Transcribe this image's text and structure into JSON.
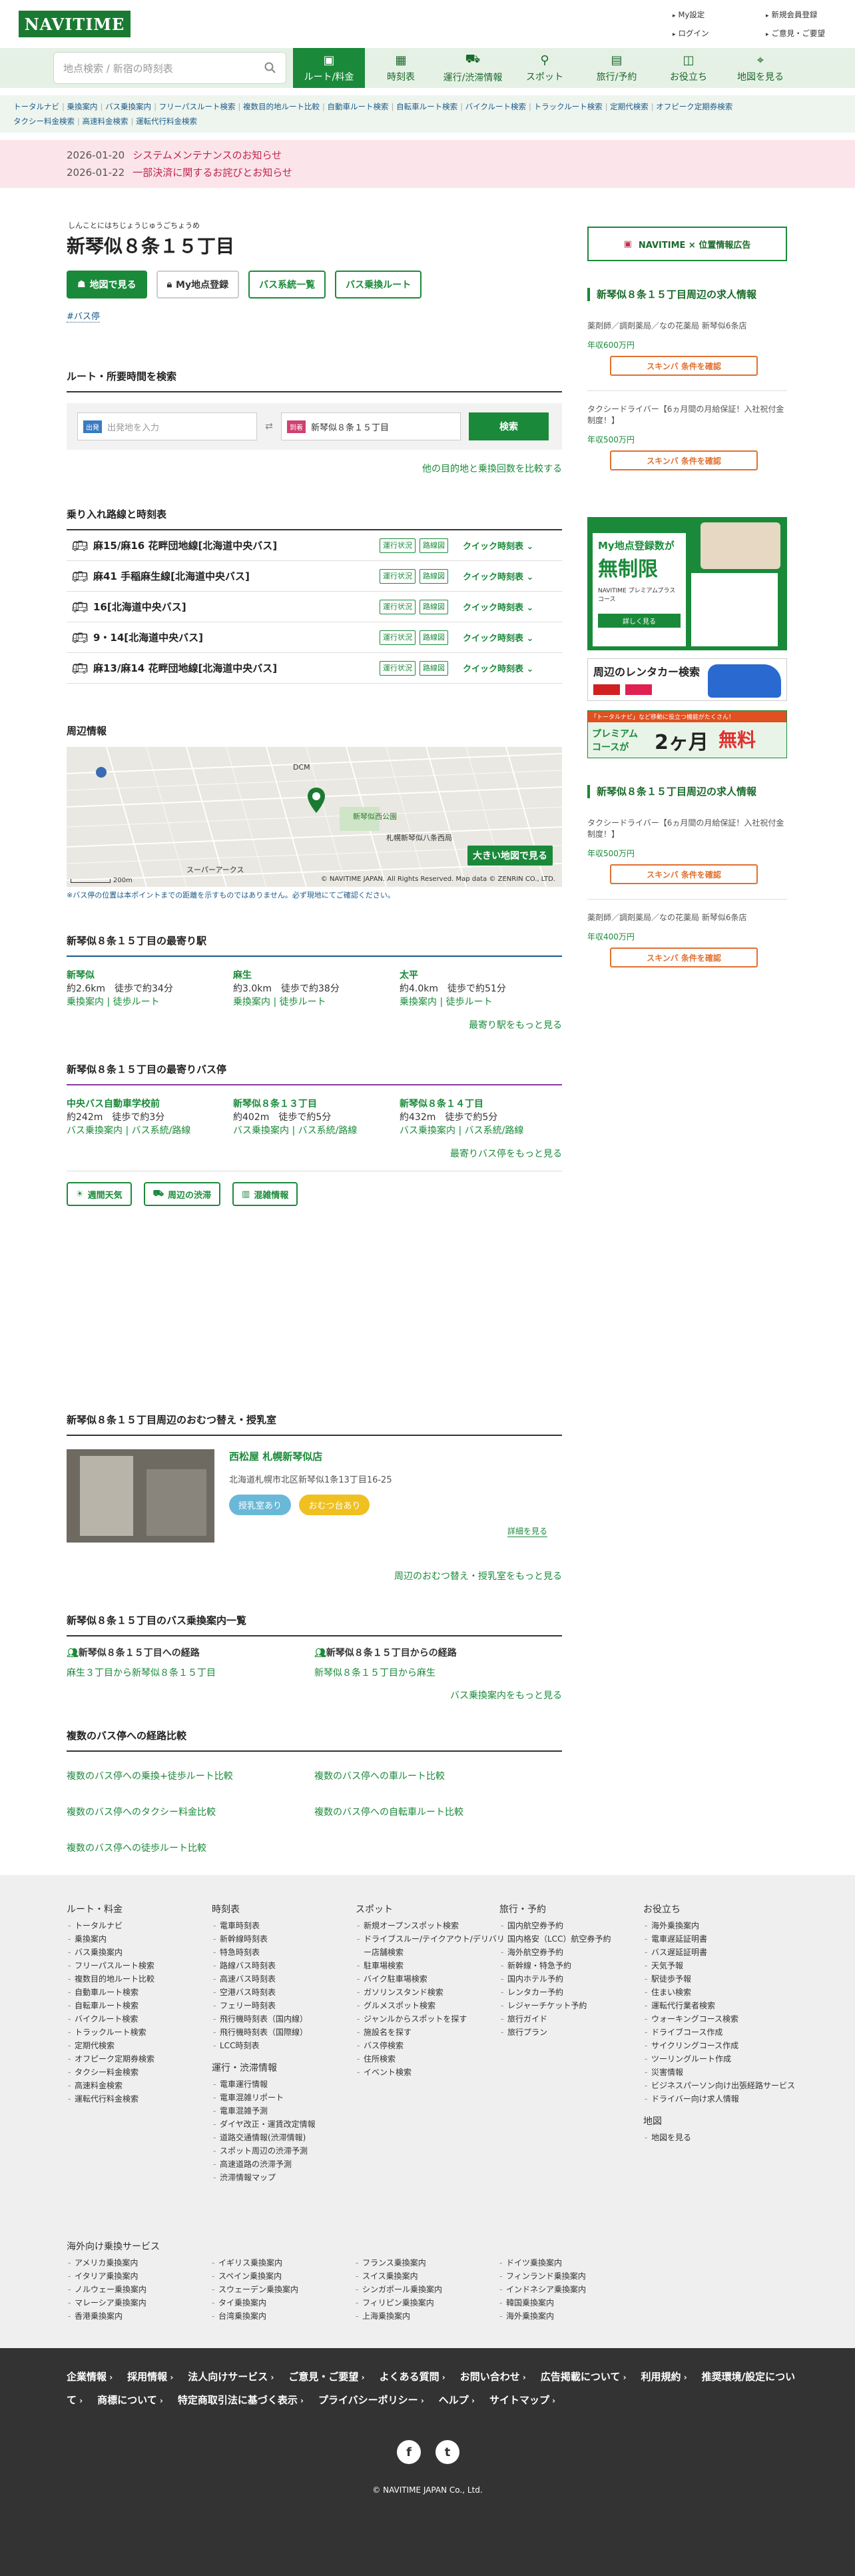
{
  "header": {
    "logo": "NAVITIME",
    "links": [
      "My設定",
      "新規会員登録",
      "ログイン",
      "ご意見・ご要望"
    ]
  },
  "nav": {
    "search_placeholder": "地点検索 / 新宿の時刻表",
    "tabs": [
      {
        "label": "ルート/料金",
        "icon": "route-icon"
      },
      {
        "label": "時刻表",
        "icon": "timetable-icon"
      },
      {
        "label": "運行/渋滞情報",
        "icon": "train-icon"
      },
      {
        "label": "スポット",
        "icon": "pin-icon"
      },
      {
        "label": "旅行/予約",
        "icon": "suitcase-icon"
      },
      {
        "label": "お役立ち",
        "icon": "gift-icon"
      },
      {
        "label": "地図を見る",
        "icon": "map-icon"
      }
    ]
  },
  "subnav": [
    "トータルナビ",
    "乗換案内",
    "バス乗換案内",
    "フリーパスルート検索",
    "複数目的地ルート比較",
    "自動車ルート検索",
    "自転車ルート検索",
    "バイクルート検索",
    "トラックルート検索",
    "定期代検索",
    "オフピーク定期券検索",
    "タクシー料金検索",
    "高速料金検索",
    "運転代行料金検索"
  ],
  "news": [
    {
      "date": "2026-01-20",
      "text": "システムメンテナンスのお知らせ"
    },
    {
      "date": "2026-01-22",
      "text": "一部決済に関するお詫びとお知らせ"
    }
  ],
  "page": {
    "ruby": "しんことにはちじょうじゅうごちょうめ",
    "title": "新琴似８条１５丁目",
    "buttons": [
      "地図で見る",
      "My地点登録",
      "バス系統一覧",
      "バス乗換ルート"
    ],
    "tag": "#バス停"
  },
  "route": {
    "heading": "ルート・所要時間を検索",
    "from_badge": "出発",
    "from_placeholder": "出発地を入力",
    "to_badge": "到着",
    "to_value": "新琴似８条１５丁目",
    "swap": "⇄",
    "search": "検索",
    "link": "他の目的地と乗換回数を比較する"
  },
  "lines": {
    "heading": "乗り入れ路線と時刻表",
    "items": [
      "麻15/麻16 花畔団地線[北海道中央バス]",
      "麻41 手稲麻生線[北海道中央バス]",
      "16[北海道中央バス]",
      "9・14[北海道中央バス]",
      "麻13/麻14 花畔団地線[北海道中央バス]"
    ],
    "status": "運行状況",
    "timetable": "路線図",
    "quick": "クイック時刻表"
  },
  "map": {
    "heading": "周辺情報",
    "labels": [
      "DCM",
      "新琴似西公園",
      "札幌新琴似八条西局",
      "スーパーアークス"
    ],
    "button": "大きい地図で見る",
    "scale": "200m",
    "copyright": "© NAVITIME JAPAN. All Rights Reserved. Map data © ZENRIN CO., LTD.",
    "note": "※バス停の位置は本ポイントまでの距離を示すものではありません。必ず現地にてご確認ください。"
  },
  "stations": {
    "heading": "新琴似８条１５丁目の最寄り駅",
    "items": [
      {
        "name": "新琴似",
        "dist": "約2.6km　徒歩で約34分",
        "links": "乗換案内 | 徒歩ルート"
      },
      {
        "name": "麻生",
        "dist": "約3.0km　徒歩で約38分",
        "links": "乗換案内 | 徒歩ルート"
      },
      {
        "name": "太平",
        "dist": "約4.0km　徒歩で約51分",
        "links": "乗換案内 | 徒歩ルート"
      }
    ],
    "more": "最寄り駅をもっと見る"
  },
  "busstops": {
    "heading": "新琴似８条１５丁目の最寄りバス停",
    "items": [
      {
        "name": "中央バス自動車学校前",
        "dist": "約242m　徒歩で約3分",
        "links": "バス乗換案内 | バス系統/路線"
      },
      {
        "name": "新琴似８条１３丁目",
        "dist": "約402m　徒歩で約5分",
        "links": "バス乗換案内 | バス系統/路線"
      },
      {
        "name": "新琴似８条１４丁目",
        "dist": "約432m　徒歩で約5分",
        "links": "バス乗換案内 | バス系統/路線"
      }
    ],
    "more": "最寄りバス停をもっと見る"
  },
  "weather": [
    "週間天気",
    "周辺の渋滞",
    "混雑情報"
  ],
  "diaper": {
    "heading": "新琴似８条１５丁目周辺のおむつ替え・授乳室",
    "name": "西松屋 札幌新琴似店",
    "address": "北海道札幌市北区新琴似1条13丁目16-25",
    "tags": [
      "授乳室あり",
      "おむつ台あり"
    ],
    "detail": "詳細を見る",
    "more": "周辺のおむつ替え・授乳室をもっと見る"
  },
  "busroute": {
    "heading": "新琴似８条１５丁目のバス乗換案内一覧",
    "to_title": "新琴似８条１５丁目への経路",
    "to_link": "麻生３丁目から新琴似８条１５丁目",
    "from_title": "新琴似８条１５丁目からの経路",
    "from_link": "新琴似８条１５丁目から麻生",
    "more": "バス乗換案内をもっと見る"
  },
  "compare": {
    "heading": "複数のバス停への経路比較",
    "links": [
      "複数のバス停への乗換+徒歩ルート比較",
      "複数のバス停への車ルート比較",
      "複数のバス停へのタクシー料金比較",
      "複数のバス停への自転車ルート比較",
      "複数のバス停への徒歩ルート比較"
    ]
  },
  "side": {
    "ad": "NAVITIME × 位置情報広告",
    "job_title": "新琴似８条１５丁目周辺の求人情報",
    "jobs": [
      {
        "text": "薬剤師／調剤薬局／なの花薬局 新琴似6条店",
        "pay": "年収600万円"
      },
      {
        "text": "タクシードライバー【6ヵ月間の月給保証！入社祝付金制度！】",
        "pay": "年収500万円"
      }
    ],
    "jobs2": [
      {
        "text": "タクシードライバー【6ヵ月間の月給保証！入社祝付金制度！】",
        "pay": "年収500万円"
      },
      {
        "text": "薬剤師／調剤薬局／なの花薬局 新琴似6条店",
        "pay": "年収400万円"
      }
    ],
    "job_btn": "スキンバ 条件を確認",
    "banner1_a": "My地点登録数が",
    "banner1_b": "無制限",
    "banner1_c": "NAVITIME プレミアムプラスコース",
    "banner1_d": "詳しく見る",
    "banner2": "周辺のレンタカー検索",
    "banner3_top": "「トータルナビ」など移動に役立つ機能がたくさん！",
    "banner3_a": "プレミアム",
    "banner3_b": "コースが",
    "banner3_c": "2ヶ月",
    "banner3_d": "無料"
  },
  "footer": {
    "cols": [
      {
        "h": "ルート・料金",
        "items": [
          "トータルナビ",
          "乗換案内",
          "バス乗換案内",
          "フリーパスルート検索",
          "複数目的地ルート比較",
          "自動車ルート検索",
          "自転車ルート検索",
          "バイクルート検索",
          "トラックルート検索",
          "定期代検索",
          "オフピーク定期券検索",
          "タクシー料金検索",
          "高速料金検索",
          "運転代行料金検索"
        ]
      },
      {
        "h": "時刻表",
        "items": [
          "電車時刻表",
          "新幹線時刻表",
          "特急時刻表",
          "路線バス時刻表",
          "高速バス時刻表",
          "空港バス時刻表",
          "フェリー時刻表",
          "飛行機時刻表（国内線）",
          "飛行機時刻表（国際線）",
          "LCC時刻表"
        ]
      },
      {
        "h": "運行・渋滞情報",
        "items": [
          "電車運行情報",
          "電車混雑リポート",
          "電車混雑予測",
          "ダイヤ改正・運賃改定情報",
          "道路交通情報(渋滞情報)",
          "スポット周辺の渋滞予測",
          "高速道路の渋滞予測",
          "渋滞情報マップ"
        ]
      },
      {
        "h": "スポット",
        "items": [
          "新規オープンスポット検索",
          "ドライブスルー/テイクアウト/デリバリー店舗検索",
          "駐車場検索",
          "バイク駐車場検索",
          "ガソリンスタンド検索",
          "グルメスポット検索",
          "ジャンルからスポットを探す",
          "施設名を探す",
          "バス停検索",
          "住所検索",
          "イベント検索"
        ]
      },
      {
        "h": "旅行・予約",
        "items": [
          "国内航空券予約",
          "国内格安（LCC）航空券予約",
          "海外航空券予約",
          "新幹線・特急予約",
          "国内ホテル予約",
          "レンタカー予約",
          "レジャーチケット予約",
          "旅行ガイド",
          "旅行プラン"
        ]
      },
      {
        "h": "お役立ち",
        "items": [
          "海外乗換案内",
          "電車遅延証明書",
          "バス遅延証明書",
          "天気予報",
          "駅徒歩予報",
          "住まい検索",
          "運転代行業者検索",
          "ウォーキングコース検索",
          "ドライブコース作成",
          "サイクリングコース作成",
          "ツーリングルート作成",
          "災害情報",
          "ビジネスパーソン向け出張経路サービス",
          "ドライバー向け求人情報"
        ]
      },
      {
        "h": "地図",
        "items": [
          "地図を見る"
        ]
      }
    ],
    "overseas_h": "海外向け乗換サービス",
    "overseas": [
      "アメリカ乗換案内",
      "イギリス乗換案内",
      "フランス乗換案内",
      "ドイツ乗換案内",
      "イタリア乗換案内",
      "スペイン乗換案内",
      "スイス乗換案内",
      "フィンランド乗換案内",
      "ノルウェー乗換案内",
      "スウェーデン乗換案内",
      "シンガポール乗換案内",
      "インドネシア乗換案内",
      "マレーシア乗換案内",
      "タイ乗換案内",
      "フィリピン乗換案内",
      "韓国乗換案内",
      "香港乗換案内",
      "台湾乗換案内",
      "上海乗換案内",
      "海外乗換案内"
    ]
  },
  "bottom": {
    "links": [
      "企業情報",
      "採用情報",
      "法人向けサービス",
      "ご意見・ご要望",
      "よくある質問",
      "お問い合わせ",
      "広告掲載について",
      "利用規約",
      "推奨環境/設定について",
      "商標について",
      "特定商取引法に基づく表示",
      "プライバシーポリシー",
      "ヘルプ",
      "サイトマップ"
    ],
    "copyright": "© NAVITIME JAPAN Co., Ltd."
  }
}
